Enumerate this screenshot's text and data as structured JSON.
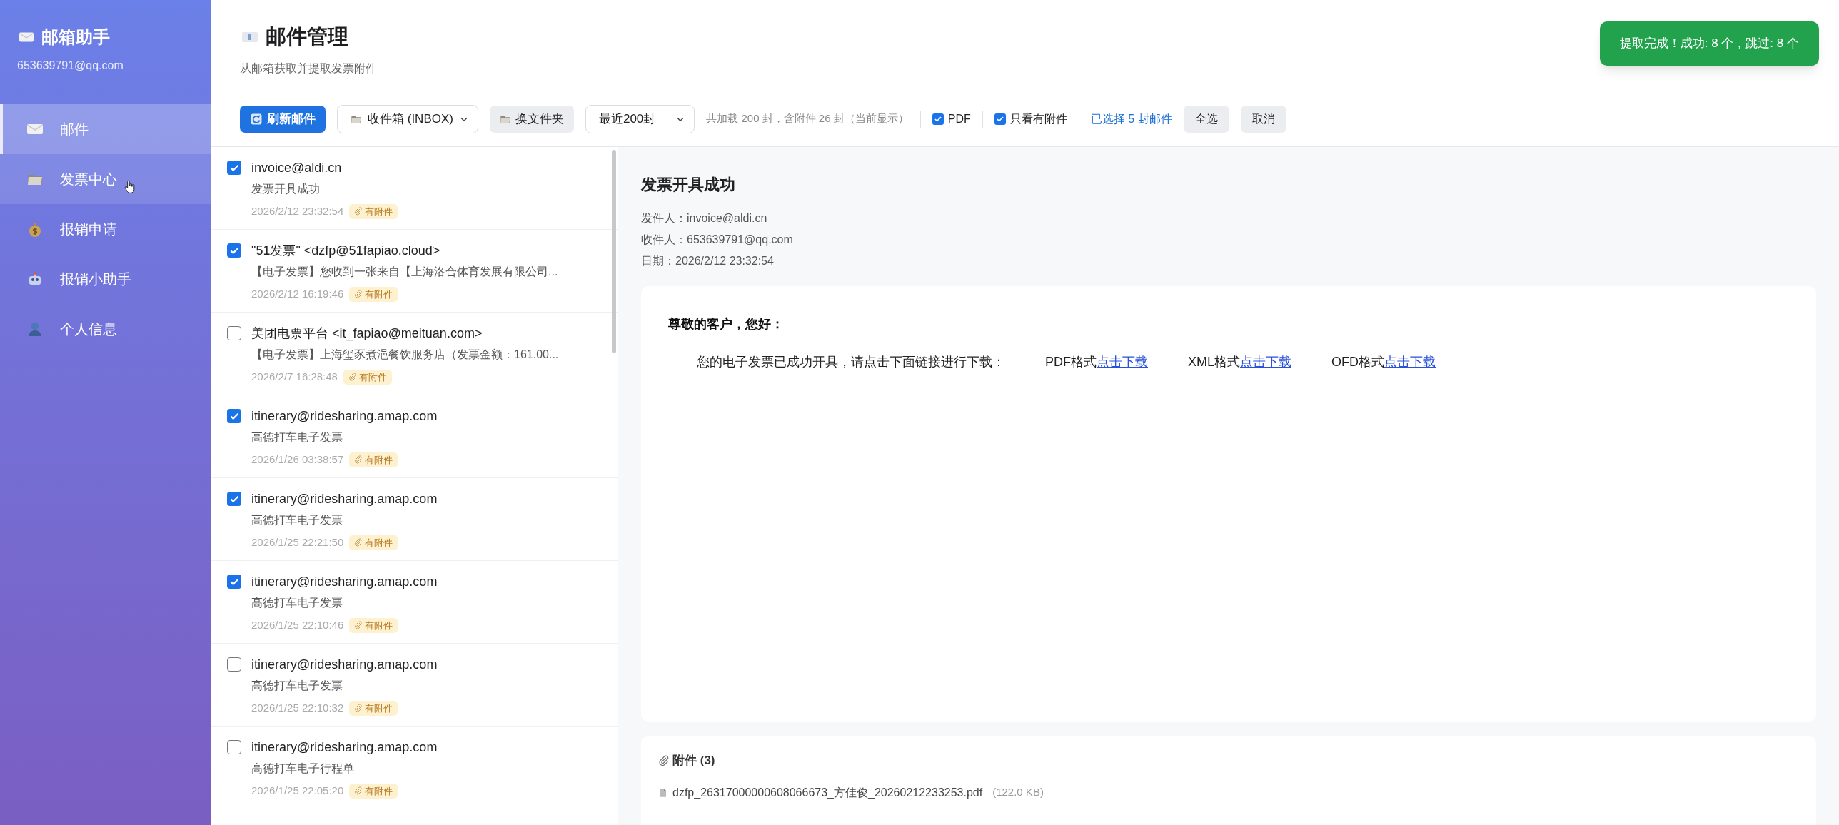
{
  "sidebar": {
    "title": "邮箱助手",
    "email": "653639791@qq.com",
    "items": [
      {
        "kind": "mail",
        "label": "邮件",
        "selected": true,
        "hovered": false
      },
      {
        "kind": "folder",
        "label": "发票中心",
        "selected": false,
        "hovered": true
      },
      {
        "kind": "money",
        "label": "报销申请",
        "selected": false,
        "hovered": false
      },
      {
        "kind": "robot",
        "label": "报销小助手",
        "selected": false,
        "hovered": false
      },
      {
        "kind": "person",
        "label": "个人信息",
        "selected": false,
        "hovered": false
      }
    ]
  },
  "header": {
    "title": "邮件管理",
    "subtitle": "从邮箱获取并提取发票附件"
  },
  "toast": "提取完成！成功: 8 个，跳过: 8 个",
  "toolbar": {
    "refresh_button": "刷新邮件",
    "folder_select": "收件箱 (INBOX)",
    "change_folder_button": "换文件夹",
    "range_select": "最近200封",
    "summary": "共加载 200 封，含附件 26 封（当前显示）",
    "filters": [
      {
        "label": "PDF",
        "checked": true
      },
      {
        "label": "只看有附件",
        "checked": true
      }
    ],
    "selection_text": "已选择 5 封邮件",
    "select_all_button": "全选",
    "cancel_button": "取消"
  },
  "emails": [
    {
      "sender": "invoice@aldi.cn",
      "subject": "发票开具成功",
      "date": "2026/2/12 23:32:54",
      "badge": "有附件",
      "checked": true
    },
    {
      "sender": "\"51发票\" <dzfp@51fapiao.cloud>",
      "subject": "【电子发票】您收到一张来自【上海洛合体育发展有限公司...",
      "date": "2026/2/12 16:19:46",
      "badge": "有附件",
      "checked": true
    },
    {
      "sender": "美团电票平台 <it_fapiao@meituan.com>",
      "subject": "【电子发票】上海玺豕煮浥餐饮服务店（发票金额：161.00...",
      "date": "2026/2/7 16:28:48",
      "badge": "有附件",
      "checked": false
    },
    {
      "sender": "itinerary@ridesharing.amap.com",
      "subject": "高德打车电子发票",
      "date": "2026/1/26 03:38:57",
      "badge": "有附件",
      "checked": true
    },
    {
      "sender": "itinerary@ridesharing.amap.com",
      "subject": "高德打车电子发票",
      "date": "2026/1/25 22:21:50",
      "badge": "有附件",
      "checked": true
    },
    {
      "sender": "itinerary@ridesharing.amap.com",
      "subject": "高德打车电子发票",
      "date": "2026/1/25 22:10:46",
      "badge": "有附件",
      "checked": true
    },
    {
      "sender": "itinerary@ridesharing.amap.com",
      "subject": "高德打车电子发票",
      "date": "2026/1/25 22:10:32",
      "badge": "有附件",
      "checked": false
    },
    {
      "sender": "itinerary@ridesharing.amap.com",
      "subject": "高德打车电子行程单",
      "date": "2026/1/25 22:05:20",
      "badge": "有附件",
      "checked": false
    }
  ],
  "detail": {
    "subject": "发票开具成功",
    "meta": [
      "发件人：invoice@aldi.cn",
      "收件人：653639791@qq.com",
      "日期：2026/2/12 23:32:54"
    ],
    "body": {
      "greeting": "尊敬的客户，您好：",
      "intro": "您的电子发票已成功开具，请点击下面链接进行下载：",
      "downloads": [
        {
          "format": "PDF格式",
          "link": "点击下载"
        },
        {
          "format": "XML格式",
          "link": "点击下载"
        },
        {
          "format": "OFD格式",
          "link": "点击下载"
        }
      ]
    },
    "attachments": {
      "title": "附件 (3)",
      "files": [
        {
          "name": "dzfp_26317000000608066673_方佳俊_20260212233253.pdf",
          "size": "(122.0 KB)"
        }
      ]
    }
  }
}
